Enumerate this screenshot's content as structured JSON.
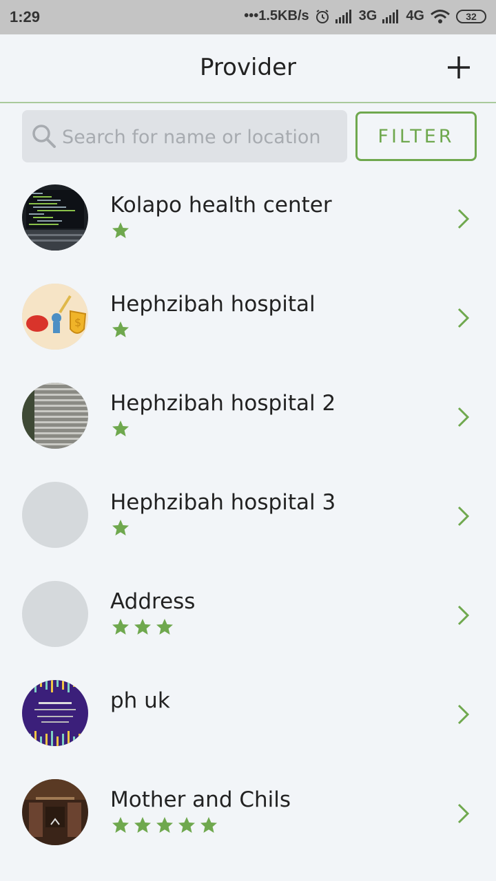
{
  "status_bar": {
    "time": "1:29",
    "speed": "•••1.5KB/s",
    "net1": "3G",
    "net2": "4G",
    "battery": "32"
  },
  "header": {
    "title": "Provider",
    "add_icon": "plus-icon"
  },
  "search": {
    "placeholder": "Search for name or location",
    "value": ""
  },
  "filter": {
    "label": "FILTER"
  },
  "colors": {
    "accent": "#6fa84e",
    "background": "#f2f5f8",
    "divider": "#a9c99b"
  },
  "providers": [
    {
      "name": "Kolapo health center",
      "rating": 1,
      "avatar": "code-screen-photo"
    },
    {
      "name": "Hephzibah hospital",
      "rating": 1,
      "avatar": "finance-illustration"
    },
    {
      "name": "Hephzibah hospital 2",
      "rating": 1,
      "avatar": "striped-photo"
    },
    {
      "name": "Hephzibah hospital 3",
      "rating": 1,
      "avatar": "empty"
    },
    {
      "name": "Address",
      "rating": 3,
      "avatar": "empty"
    },
    {
      "name": "ph uk",
      "rating": 0,
      "avatar": "purple-flyer"
    },
    {
      "name": "Mother and Chils",
      "rating": 5,
      "avatar": "dark-interior-photo"
    }
  ]
}
